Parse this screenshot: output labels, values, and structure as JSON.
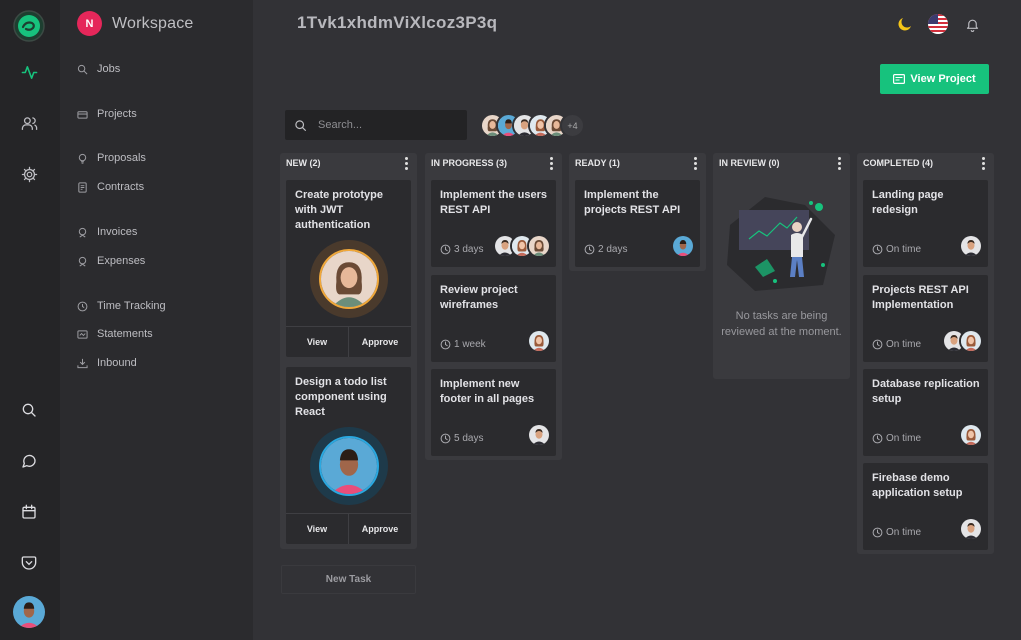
{
  "workspace": {
    "initial": "N",
    "name": "Workspace"
  },
  "nav": [
    {
      "label": "Jobs",
      "icon": "search-icon"
    },
    {
      "label": "Projects",
      "icon": "folder-icon"
    },
    {
      "label": "Proposals",
      "icon": "proposal-icon"
    },
    {
      "label": "Contracts",
      "icon": "document-icon"
    },
    {
      "label": "Invoices",
      "icon": "invoice-icon"
    },
    {
      "label": "Expenses",
      "icon": "expense-icon"
    },
    {
      "label": "Time Tracking",
      "icon": "clock-icon"
    },
    {
      "label": "Statements",
      "icon": "statement-icon"
    },
    {
      "label": "Inbound",
      "icon": "download-icon"
    }
  ],
  "rail_icons": [
    "logo-icon",
    "activity-icon",
    "users-icon",
    "settings-icon",
    "search-icon",
    "chat-icon",
    "calendar-icon",
    "pocket-icon",
    "user-avatar"
  ],
  "header": {
    "project_id": "1Tvk1xhdmViXlcoz3P3q",
    "view_project_label": "View Project",
    "theme_icon": "moon-icon",
    "language_icon": "us-flag-icon",
    "notifications_icon": "bell-icon"
  },
  "search": {
    "placeholder": "Search..."
  },
  "team": {
    "more_label": "+4"
  },
  "colors": {
    "accent": "#17c27d",
    "workspace_badge": "#e5275a",
    "background": "#323236",
    "column": "#3a3a3e",
    "card": "#2b2b2e"
  },
  "board": {
    "columns": [
      {
        "title": "NEW (2)",
        "cards": [
          {
            "title": "Create prototype with JWT authentication",
            "view_label": "View",
            "approve_label": "Approve"
          },
          {
            "title": "Design a todo list component using React",
            "view_label": "View",
            "approve_label": "Approve"
          }
        ]
      },
      {
        "title": "IN PROGRESS (3)",
        "cards": [
          {
            "title": "Implement the users REST API",
            "meta": "3 days"
          },
          {
            "title": "Review project wireframes",
            "meta": "1 week"
          },
          {
            "title": "Implement new footer in all pages",
            "meta": "5 days"
          }
        ]
      },
      {
        "title": "READY (1)",
        "cards": [
          {
            "title": "Implement the projects REST API",
            "meta": "2 days"
          }
        ]
      },
      {
        "title": "IN REVIEW (0)",
        "empty_text": "No tasks are being reviewed at the moment."
      },
      {
        "title": "COMPLETED (4)",
        "cards": [
          {
            "title": "Landing page redesign",
            "meta": "On time"
          },
          {
            "title": "Projects REST API Implementation",
            "meta": "On time"
          },
          {
            "title": "Database replication setup",
            "meta": "On time"
          },
          {
            "title": "Firebase demo application setup",
            "meta": "On time"
          }
        ]
      }
    ],
    "new_task_label": "New Task"
  }
}
